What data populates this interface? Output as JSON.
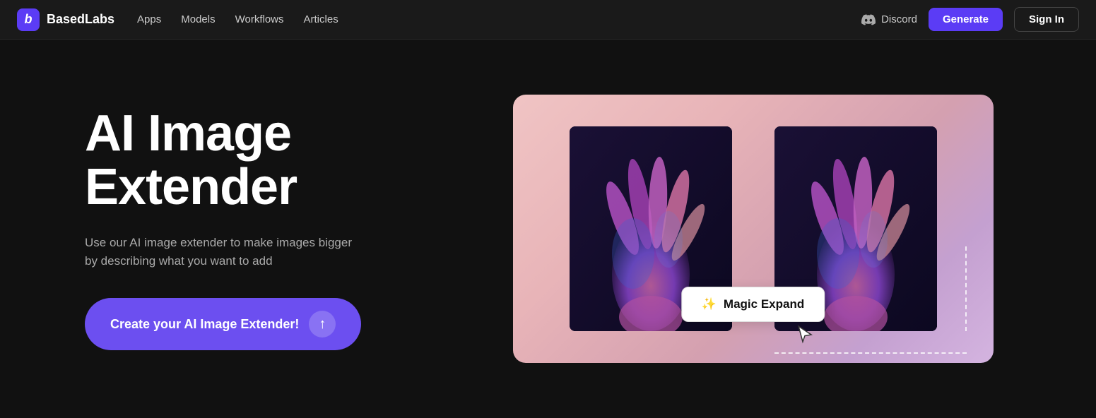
{
  "nav": {
    "logo_text": "BasedLabs",
    "logo_letter": "b",
    "links": [
      {
        "label": "Apps",
        "id": "apps"
      },
      {
        "label": "Models",
        "id": "models"
      },
      {
        "label": "Workflows",
        "id": "workflows"
      },
      {
        "label": "Articles",
        "id": "articles"
      }
    ],
    "discord_label": "Discord",
    "generate_label": "Generate",
    "signin_label": "Sign In"
  },
  "hero": {
    "title_line1": "AI Image",
    "title_line2": "Extender",
    "description": "Use our AI image extender to make images bigger by describing what you want to add",
    "cta_label": "Create your AI Image Extender!",
    "cta_icon": "↑"
  },
  "demo": {
    "magic_expand_label": "Magic Expand",
    "magic_wand_icon": "✨"
  }
}
